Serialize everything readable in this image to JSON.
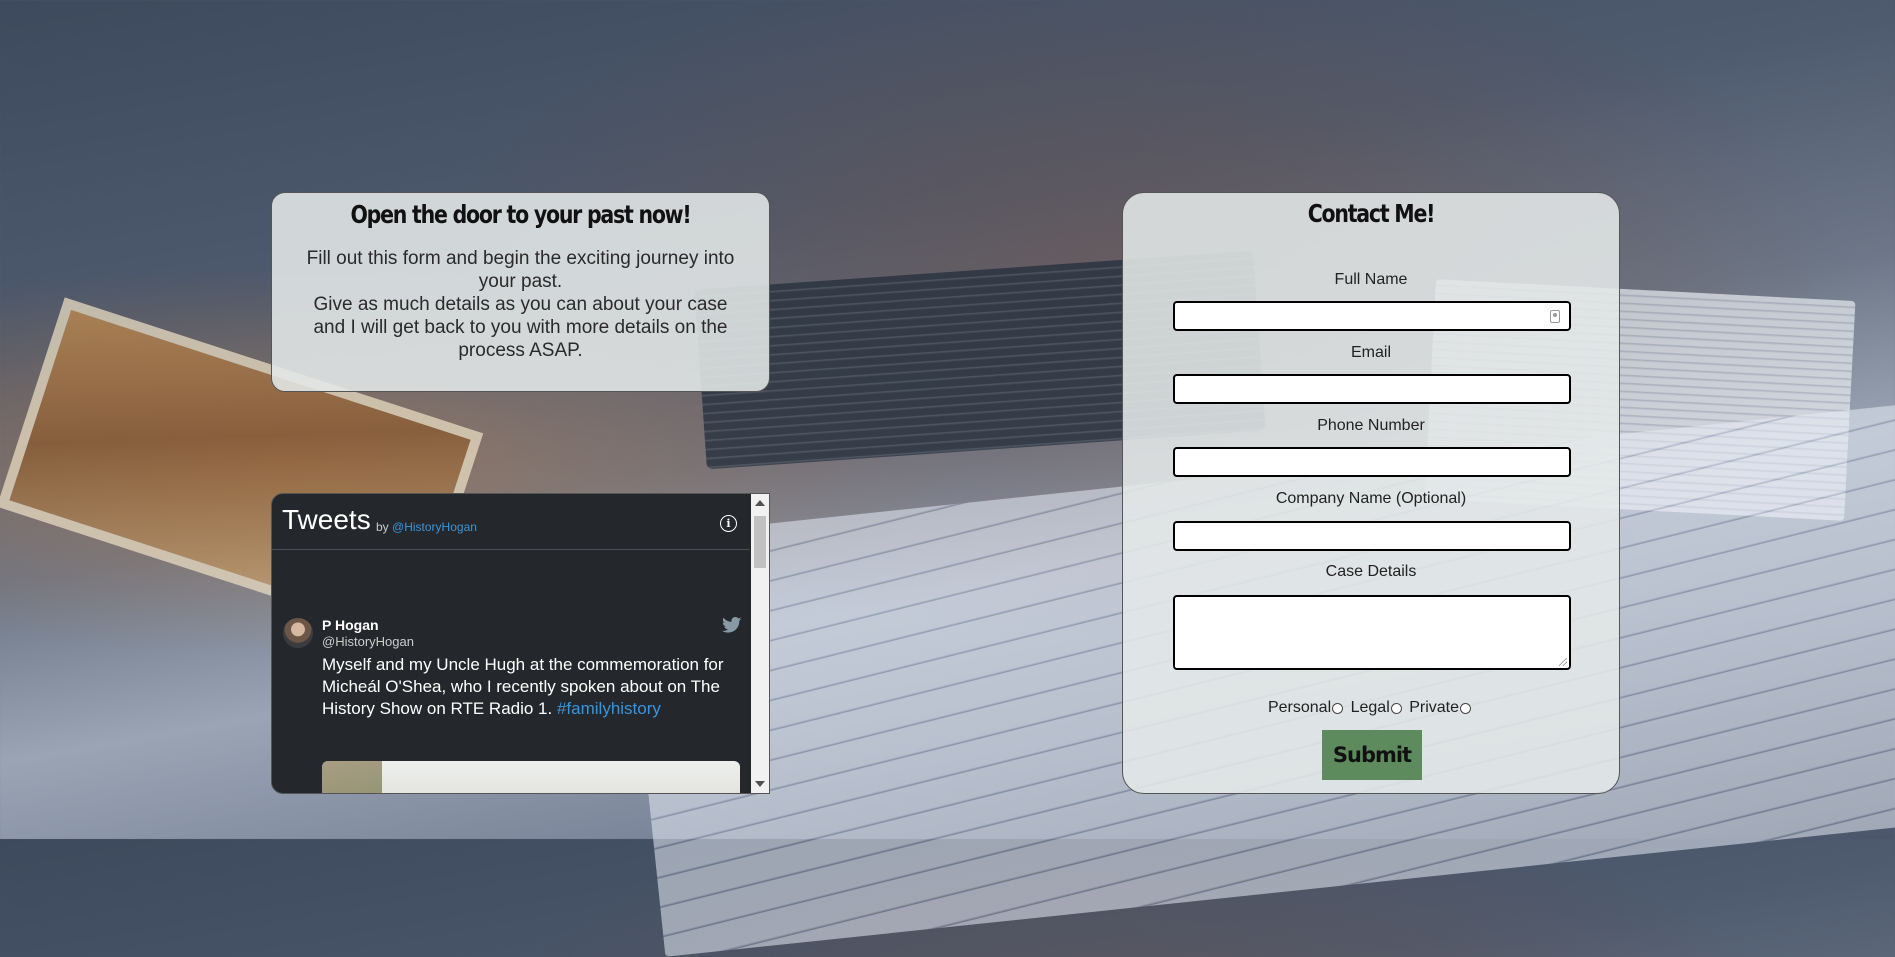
{
  "intro": {
    "title": "Open the door to your past now!",
    "paragraph1": "Fill out this form and begin the exciting journey into your past.",
    "paragraph2": "Give as much details as you can about your case and I will get back to you with more details on the process ASAP."
  },
  "tweets": {
    "title": "Tweets",
    "by_label": "by",
    "handle_link": "@HistoryHogan",
    "tweet": {
      "author_name": "P Hogan",
      "author_handle": "@HistoryHogan",
      "text": "Myself and my Uncle Hugh at the commemoration for Micheál O'Shea, who I recently spoken about on The History Show on RTE Radio 1.",
      "hashtag": "#familyhistory"
    }
  },
  "contact": {
    "title": "Contact Me!",
    "fields": {
      "full_name": "Full Name",
      "email": "Email",
      "phone": "Phone Number",
      "company": "Company Name (Optional)",
      "case_details": "Case Details"
    },
    "radio_options": [
      "Personal",
      "Legal",
      "Private"
    ],
    "submit_label": "Submit"
  }
}
